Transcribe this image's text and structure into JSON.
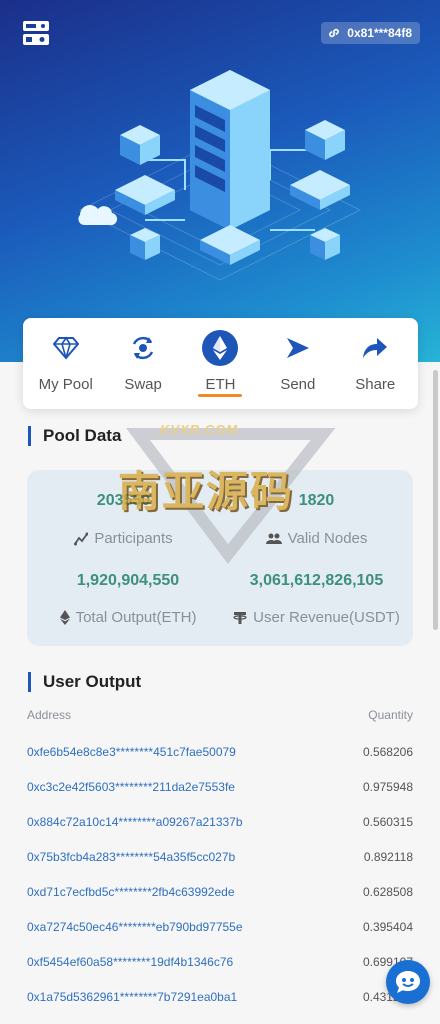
{
  "header": {
    "menu_icon": "server-menu-icon",
    "wallet_address": "0x81***84f8",
    "wallet_icon": "link-icon"
  },
  "actions": [
    {
      "label": "My Pool",
      "icon": "diamond-icon"
    },
    {
      "label": "Swap",
      "icon": "swap-cycle-icon"
    },
    {
      "label": "ETH",
      "icon": "ethereum-icon",
      "active": true
    },
    {
      "label": "Send",
      "icon": "send-arrow-icon"
    },
    {
      "label": "Share",
      "icon": "share-arrow-icon"
    }
  ],
  "pool": {
    "title": "Pool Data",
    "participants_value": "203550",
    "participants_label": "Participants",
    "valid_nodes_value": "1820",
    "valid_nodes_label": "Valid Nodes",
    "total_output_value": "1,920,904,550",
    "total_output_label": "Total Output(ETH)",
    "user_revenue_value": "3,061,612,826,105",
    "user_revenue_label": "User Revenue(USDT)"
  },
  "watermark": {
    "site": "KVXR.COM",
    "text": "南亚源码"
  },
  "user_output": {
    "title": "User Output",
    "col_address": "Address",
    "col_quantity": "Quantity",
    "rows": [
      {
        "address": "0xfe6b54e8c8e3********451c7fae50079",
        "quantity": "0.568206"
      },
      {
        "address": "0xc3c2e42f5603********211da2e7553fe",
        "quantity": "0.975948"
      },
      {
        "address": "0x884c72a10c14********a09267a21337b",
        "quantity": "0.560315"
      },
      {
        "address": "0x75b3fcb4a283********54a35f5cc027b",
        "quantity": "0.892118"
      },
      {
        "address": "0xd71c7ecfbd5c********2fb4c63992ede",
        "quantity": "0.628508"
      },
      {
        "address": "0xa7274c50ec46********eb790bd97755e",
        "quantity": "0.395404"
      },
      {
        "address": "0xf5454ef60a58********19df4b1346c76",
        "quantity": "0.699107"
      },
      {
        "address": "0x1a75d5362961********7b7291ea0ba1",
        "quantity": "0.431201"
      }
    ]
  },
  "chat_icon": "chat-support-icon",
  "colors": {
    "accent": "#1d55b8",
    "active_underline": "#f08a24",
    "value_green": "#3d8f7f",
    "address_blue": "#2e6fc0"
  }
}
